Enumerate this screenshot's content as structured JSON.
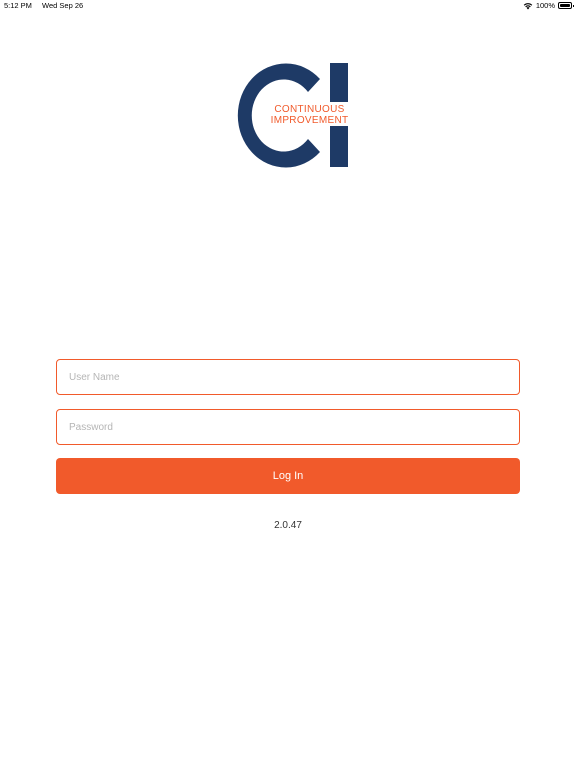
{
  "status_bar": {
    "time": "5:12 PM",
    "date": "Wed Sep 26",
    "battery": "100%"
  },
  "logo": {
    "line1": "CONTINUOUS",
    "line2": "IMPROVEMENT",
    "brand_navy": "#1e3a66",
    "brand_orange": "#f15a2b"
  },
  "login": {
    "username_placeholder": "User Name",
    "password_placeholder": "Password",
    "button_label": "Log In"
  },
  "version": "2.0.47"
}
